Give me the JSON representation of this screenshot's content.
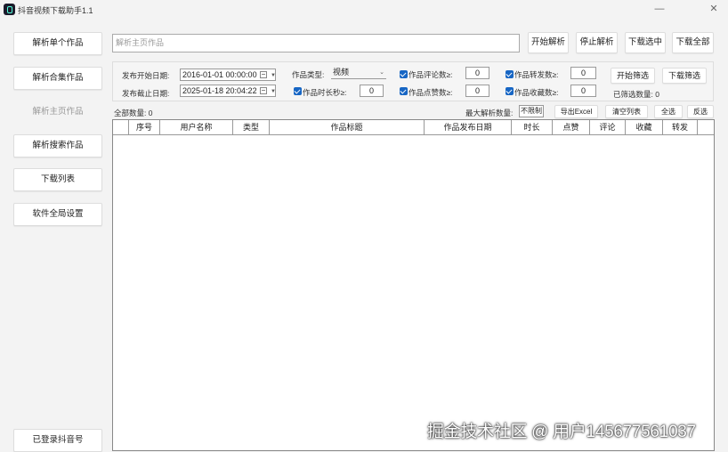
{
  "window": {
    "title": "抖音视频下载助手1.1",
    "minimize": "—",
    "close": "✕"
  },
  "sidebar": {
    "items": [
      {
        "label": "解析单个作品"
      },
      {
        "label": "解析合集作品"
      },
      {
        "label": "解析主页作品",
        "active": true
      },
      {
        "label": "解析搜索作品"
      },
      {
        "label": "下载列表"
      },
      {
        "label": "软件全局设置"
      }
    ],
    "login": "已登录抖音号"
  },
  "url_input": {
    "placeholder": "解析主页作品",
    "value": ""
  },
  "top_buttons": {
    "start": "开始解析",
    "stop": "停止解析",
    "download_selected": "下载选中",
    "download_all": "下载全部"
  },
  "filters": {
    "start_date_label": "发布开始日期:",
    "start_date": "2016-01-01 00:00:00",
    "end_date_label": "发布截止日期:",
    "end_date": "2025-01-18 20:04:22",
    "type_label": "作品类型:",
    "type_value": "视频",
    "duration_label": "作品时长秒≥:",
    "duration_value": "0",
    "comments_label": "作品评论数≥:",
    "comments_value": "0",
    "likes_label": "作品点赞数≥:",
    "likes_value": "0",
    "shares_label": "作品转发数≥:",
    "shares_value": "0",
    "favorites_label": "作品收藏数≥:",
    "favorites_value": "0",
    "start_filter": "开始筛选",
    "download_filter": "下载筛选",
    "filtered_count": "已筛选数量: 0"
  },
  "list_bar": {
    "total_count": "全部数量: 0",
    "max_label": "最大解析数量:",
    "max_value": "不限制",
    "export": "导出Excel",
    "clear": "清空列表",
    "select_all": "全选",
    "invert": "反选"
  },
  "table": {
    "columns": [
      "",
      "序号",
      "用户名称",
      "类型",
      "作品标题",
      "作品发布日期",
      "时长",
      "点赞",
      "评论",
      "收藏",
      "转发",
      ""
    ],
    "rows": []
  },
  "watermark": "掘金技术社区 @ 用户145677561037",
  "colors": {
    "checkbox": "#1766c4",
    "border": "#dddddd"
  }
}
